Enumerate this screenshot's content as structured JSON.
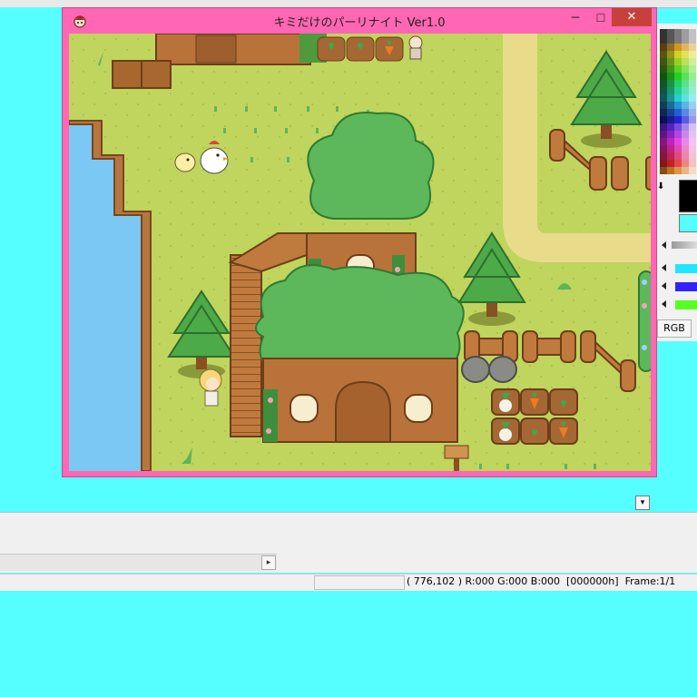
{
  "window": {
    "title": "キミだけのパーリナイト  Ver1.0",
    "min_label": "─",
    "max_label": "☐",
    "close_label": "✕"
  },
  "editor": {
    "status": "( 776,102 ) R:000 G:000 B:000  [000000h]  Frame:1/1",
    "rgb_tab": "RGB"
  },
  "colors": {
    "window_frame": "#ff66b3",
    "close_button": "#c7413a",
    "grass": "#bcd45d",
    "path": "#e6dc8c",
    "water": "#7cc8f4",
    "wood": "#b9733a",
    "leaves": "#5ab85a",
    "background": "#55ffff"
  },
  "scene": {
    "characters": [
      "chick",
      "chicken",
      "blonde-girl",
      "villager"
    ],
    "objects": [
      "treehouse",
      "pine-tree",
      "fence",
      "clay-pot",
      "vegetable-patch",
      "signpost",
      "water-pond"
    ]
  }
}
